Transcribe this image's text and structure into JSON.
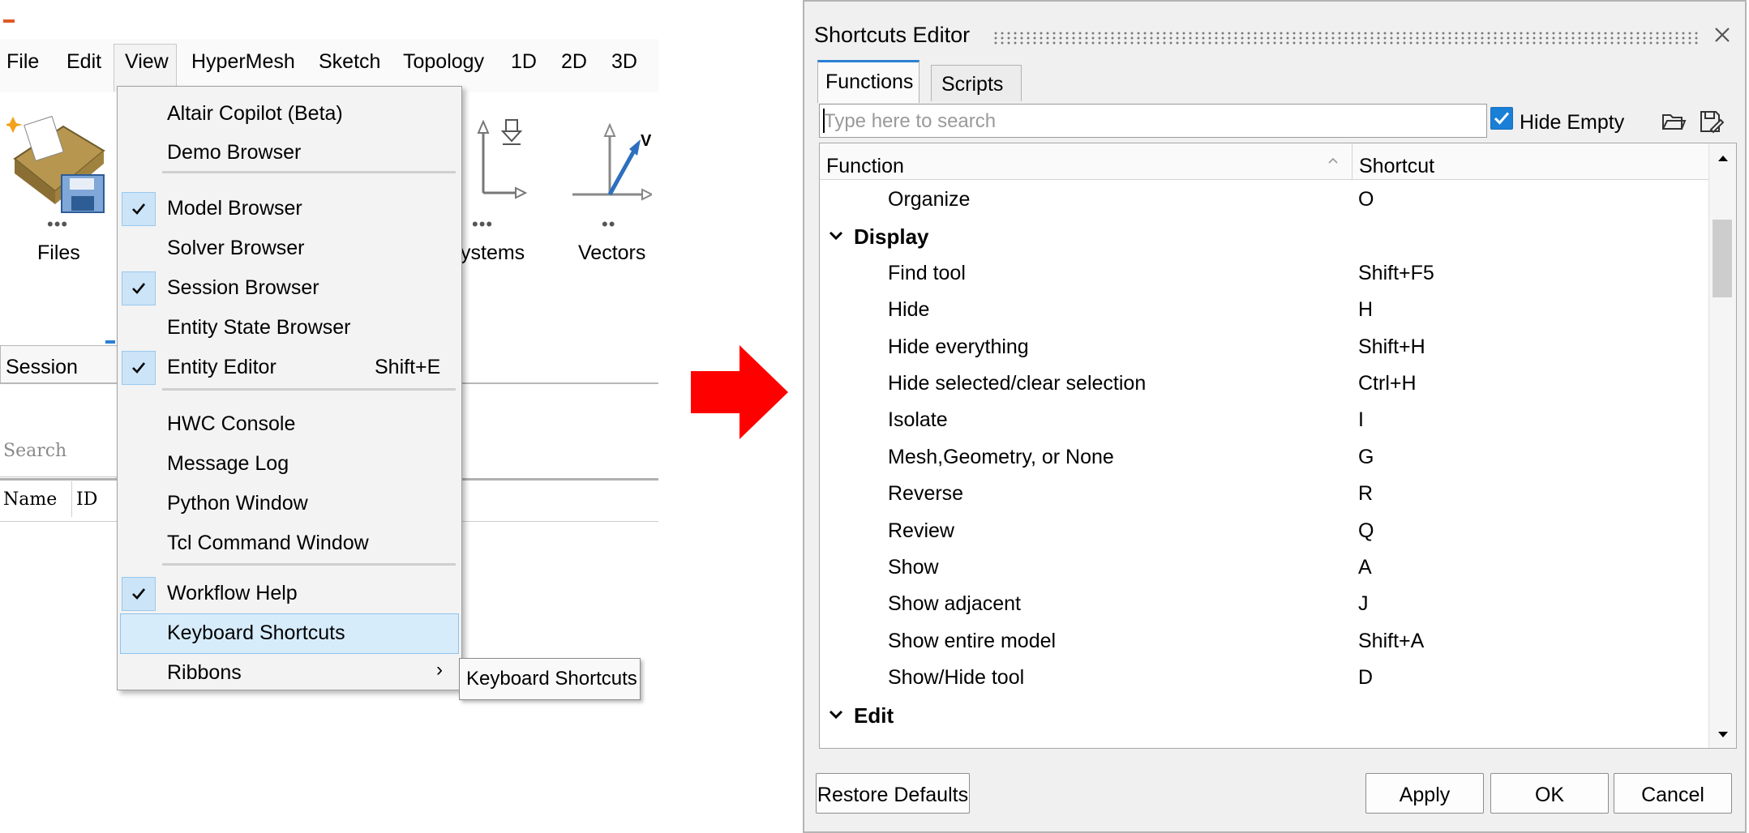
{
  "app": {
    "menubar": [
      "File",
      "Edit",
      "View",
      "HyperMesh",
      "Sketch",
      "Topology",
      "1D",
      "2D",
      "3D"
    ],
    "ribbon": {
      "files_label": "Files",
      "systems_label": "ystems",
      "vectors_label": "Vectors"
    },
    "session_tab": "Session",
    "search_placeholder": "Search",
    "columns": {
      "name": "Name",
      "id": "ID"
    }
  },
  "view_menu": {
    "items": [
      {
        "label": "Altair Copilot (Beta)",
        "checked": false
      },
      {
        "label": "Demo Browser",
        "checked": false
      },
      {
        "label": "Model Browser",
        "checked": true
      },
      {
        "label": "Solver Browser",
        "checked": false
      },
      {
        "label": "Session Browser",
        "checked": true
      },
      {
        "label": "Entity State Browser",
        "checked": false
      },
      {
        "label": "Entity Editor",
        "checked": true,
        "shortcut": "Shift+E"
      },
      {
        "label": "HWC Console",
        "checked": false
      },
      {
        "label": "Message Log",
        "checked": false
      },
      {
        "label": "Python Window",
        "checked": false
      },
      {
        "label": "Tcl Command Window",
        "checked": false
      },
      {
        "label": "Workflow Help",
        "checked": true
      },
      {
        "label": "Keyboard Shortcuts",
        "checked": false,
        "highlighted": true
      },
      {
        "label": "Ribbons",
        "checked": false,
        "submenu": true
      }
    ],
    "tooltip": "Keyboard Shortcuts"
  },
  "arrow_color": "#ff0000",
  "dialog": {
    "title": "Shortcuts Editor",
    "tabs": [
      "Functions",
      "Scripts"
    ],
    "search_placeholder": "Type here to search",
    "hide_empty_label": "Hide Empty",
    "hide_empty_checked": true,
    "columns": {
      "function": "Function",
      "shortcut": "Shortcut"
    },
    "rows": [
      {
        "type": "item",
        "function": "Organize",
        "shortcut": "O"
      },
      {
        "type": "group",
        "function": "Display"
      },
      {
        "type": "item",
        "function": "Find tool",
        "shortcut": "Shift+F5"
      },
      {
        "type": "item",
        "function": "Hide",
        "shortcut": "H"
      },
      {
        "type": "item",
        "function": "Hide everything",
        "shortcut": "Shift+H"
      },
      {
        "type": "item",
        "function": "Hide selected/clear selection",
        "shortcut": "Ctrl+H"
      },
      {
        "type": "item",
        "function": "Isolate",
        "shortcut": "I"
      },
      {
        "type": "item",
        "function": "Mesh,Geometry, or None",
        "shortcut": "G"
      },
      {
        "type": "item",
        "function": "Reverse",
        "shortcut": "R"
      },
      {
        "type": "item",
        "function": "Review",
        "shortcut": "Q"
      },
      {
        "type": "item",
        "function": "Show",
        "shortcut": "A"
      },
      {
        "type": "item",
        "function": "Show adjacent",
        "shortcut": "J"
      },
      {
        "type": "item",
        "function": "Show entire model",
        "shortcut": "Shift+A"
      },
      {
        "type": "item",
        "function": "Show/Hide tool",
        "shortcut": "D"
      },
      {
        "type": "group",
        "function": "Edit"
      }
    ],
    "buttons": {
      "restore": "Restore Defaults",
      "apply": "Apply",
      "ok": "OK",
      "cancel": "Cancel"
    },
    "accent_color": "#1a7fd6"
  }
}
